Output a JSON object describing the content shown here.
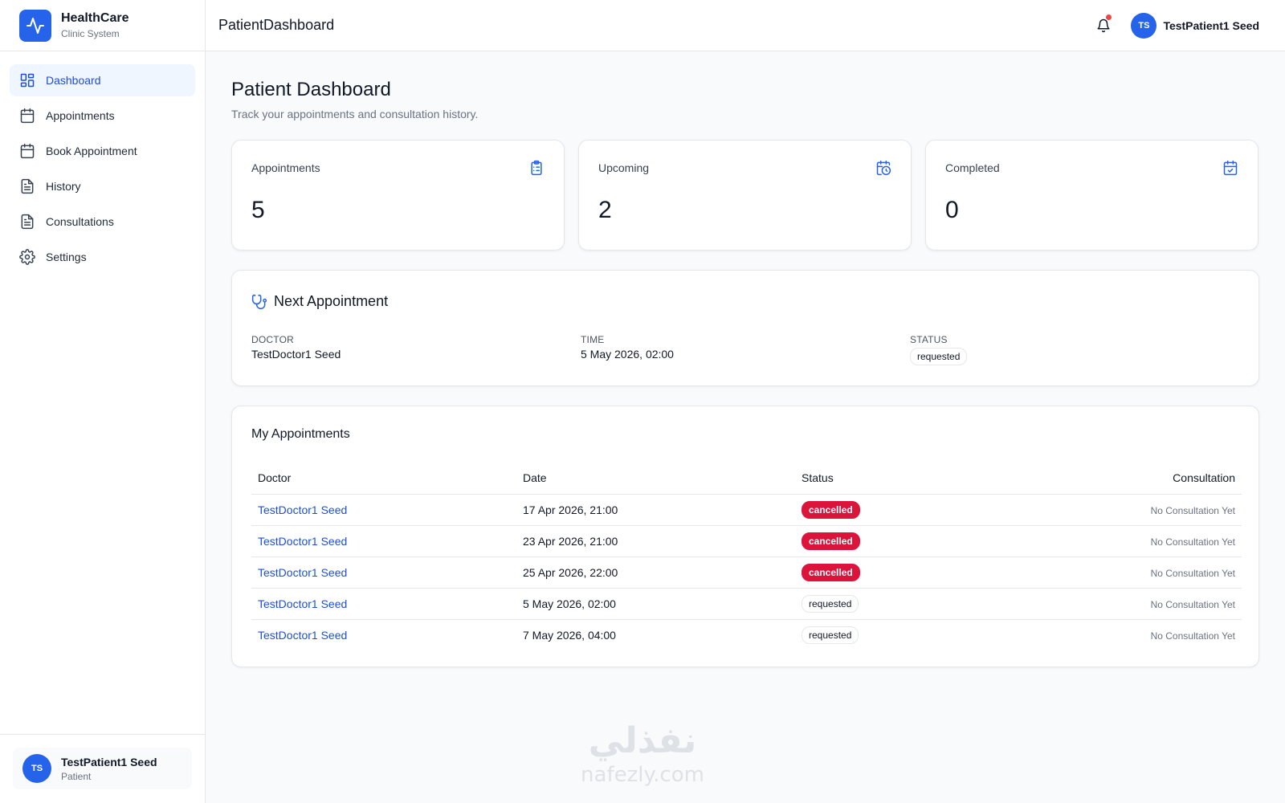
{
  "brand": {
    "title": "HealthCare",
    "subtitle": "Clinic System",
    "logo_icon": "activity-icon",
    "accent": "#2563eb"
  },
  "sidebar": {
    "items": [
      {
        "label": "Dashboard",
        "icon": "layout-dashboard-icon",
        "active": true
      },
      {
        "label": "Appointments",
        "icon": "calendar-icon"
      },
      {
        "label": "Book Appointment",
        "icon": "calendar-icon"
      },
      {
        "label": "History",
        "icon": "file-text-icon"
      },
      {
        "label": "Consultations",
        "icon": "file-text-icon"
      },
      {
        "label": "Settings",
        "icon": "gear-icon"
      }
    ],
    "user": {
      "initials": "TS",
      "name": "TestPatient1 Seed",
      "role": "Patient"
    }
  },
  "header": {
    "title": "PatientDashboard",
    "user": {
      "initials": "TS",
      "name": "TestPatient1 Seed"
    }
  },
  "page": {
    "title": "Patient Dashboard",
    "subtitle": "Track your appointments and consultation history."
  },
  "stats": [
    {
      "label": "Appointments",
      "value": "5",
      "icon": "clipboard-list-icon"
    },
    {
      "label": "Upcoming",
      "value": "2",
      "icon": "calendar-clock-icon"
    },
    {
      "label": "Completed",
      "value": "0",
      "icon": "calendar-check-icon"
    }
  ],
  "next_appointment": {
    "title": "Next Appointment",
    "icon": "stethoscope-icon",
    "doctor_label": "DOCTOR",
    "doctor": "TestDoctor1 Seed",
    "time_label": "TIME",
    "time": "5 May 2026, 02:00",
    "status_label": "STATUS",
    "status": "requested"
  },
  "appointments": {
    "title": "My Appointments",
    "columns": [
      "Doctor",
      "Date",
      "Status",
      "Consultation"
    ],
    "rows": [
      {
        "doctor": "TestDoctor1 Seed",
        "date": "17 Apr 2026, 21:00",
        "status": "cancelled",
        "consultation": "No Consultation Yet"
      },
      {
        "doctor": "TestDoctor1 Seed",
        "date": "23 Apr 2026, 21:00",
        "status": "cancelled",
        "consultation": "No Consultation Yet"
      },
      {
        "doctor": "TestDoctor1 Seed",
        "date": "25 Apr 2026, 22:00",
        "status": "cancelled",
        "consultation": "No Consultation Yet"
      },
      {
        "doctor": "TestDoctor1 Seed",
        "date": "5 May 2026, 02:00",
        "status": "requested",
        "consultation": "No Consultation Yet"
      },
      {
        "doctor": "TestDoctor1 Seed",
        "date": "7 May 2026, 04:00",
        "status": "requested",
        "consultation": "No Consultation Yet"
      }
    ]
  },
  "colors": {
    "cancelled": "#dc143c",
    "link": "#1d4ed8",
    "notification_dot": "#ef4444"
  },
  "watermark": {
    "text_ar": "نفذلي",
    "text_en": "nafezly.com"
  }
}
